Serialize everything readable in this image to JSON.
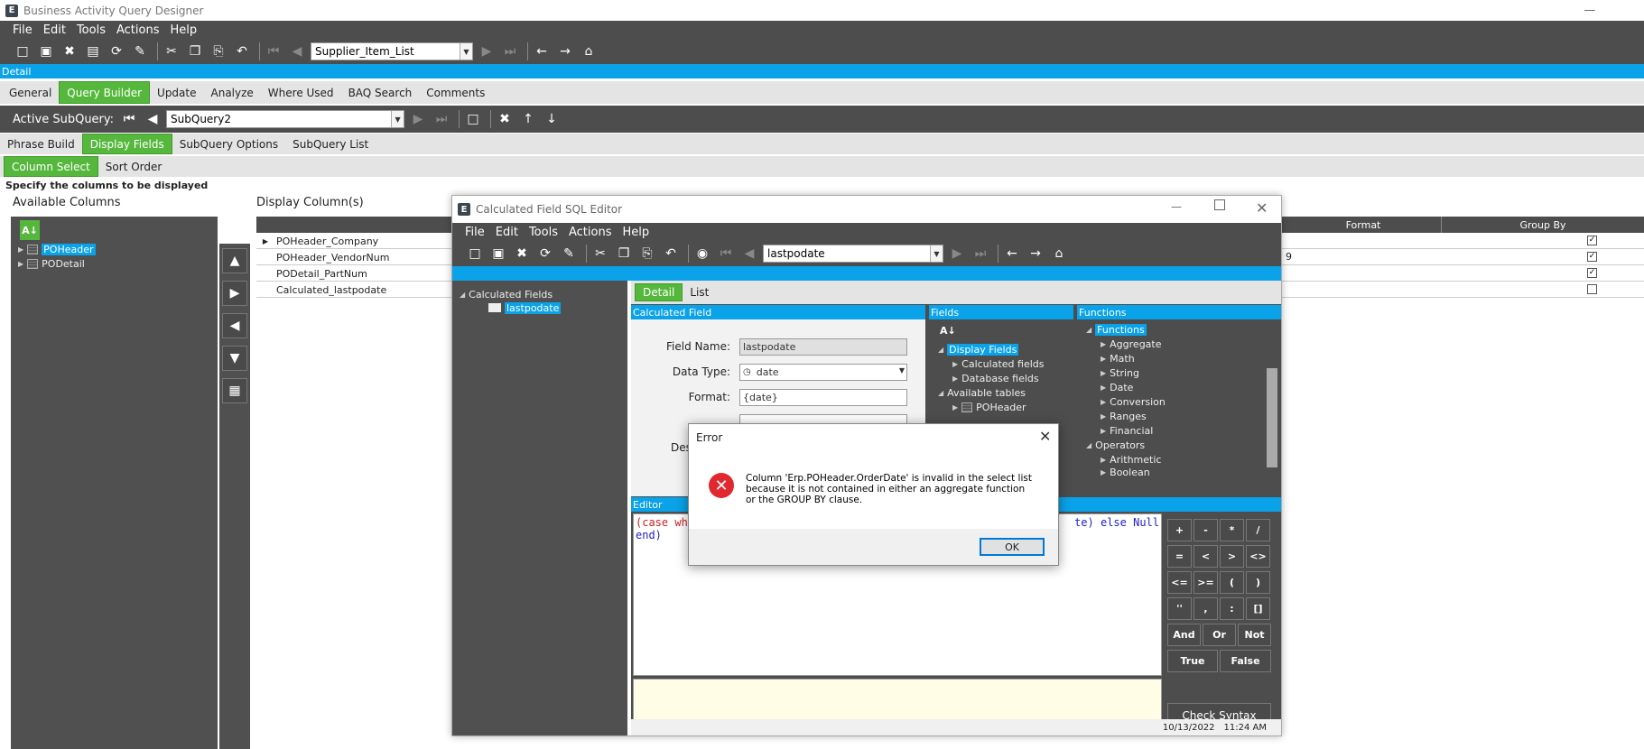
{
  "app": {
    "logo": "E",
    "title": "Business Activity Query Designer"
  },
  "menu": [
    "File",
    "Edit",
    "Tools",
    "Actions",
    "Help"
  ],
  "toolbar": {
    "query_name": "Supplier_Item_List"
  },
  "detail_bar": "Detail",
  "main_tabs": [
    "General",
    "Query Builder",
    "Update",
    "Analyze",
    "Where Used",
    "BAQ Search",
    "Comments"
  ],
  "subquery": {
    "label": "Active SubQuery:",
    "value": "SubQuery2"
  },
  "sub_tabs": [
    "Phrase Build",
    "Display Fields",
    "SubQuery Options",
    "SubQuery List"
  ],
  "col_tabs": [
    "Column Select",
    "Sort Order"
  ],
  "instruction": "Specify the columns to be displayed",
  "available_columns": {
    "label": "Available Columns",
    "items": [
      "POHeader",
      "PODetail"
    ]
  },
  "display_columns": {
    "label": "Display Column(s)",
    "headers": {
      "format": "Format",
      "group_by": "Group By"
    },
    "rows": [
      {
        "name": "POHeader_Company",
        "group_by": true
      },
      {
        "name": "POHeader_VendorNum",
        "group_by": true,
        "format_fragment": "9"
      },
      {
        "name": "PODetail_PartNum",
        "group_by": true
      },
      {
        "name": "Calculated_lastpodate",
        "group_by": false
      }
    ]
  },
  "calc_editor": {
    "title": "Calculated Field SQL Editor",
    "menu": [
      "File",
      "Edit",
      "Tools",
      "Actions",
      "Help"
    ],
    "combo_value": "lastpodate",
    "tree_root": "Calculated Fields",
    "tree_item": "lastpodate",
    "tabs": [
      "Detail",
      "List"
    ],
    "calc_field_header": "Calculated Field",
    "field_name_label": "Field Name:",
    "field_name": "lastpodate",
    "data_type_label": "Data Type:",
    "data_type": "date",
    "format_label": "Format:",
    "format": "{date}",
    "desc_label_fragment": "Des",
    "fields_header": "Fields",
    "fields_tree": [
      "Display Fields",
      "Calculated fields",
      "Database fields",
      "Available tables",
      "POHeader"
    ],
    "functions_header": "Functions",
    "functions_tree": [
      "Functions",
      "Aggregate",
      "Math",
      "String",
      "Date",
      "Conversion",
      "Ranges",
      "Financial",
      "Operators",
      "Arithmetic",
      "Boolean"
    ],
    "editor_header": "Editor",
    "code_line1_start": "(case whe",
    "code_line1_end": "te) else Null",
    "code_line2": "end)",
    "keypad": [
      "+",
      "-",
      "*",
      "/",
      "=",
      "<",
      ">",
      "<>",
      "<=",
      ">=",
      "(",
      ")",
      "''",
      ",",
      ":",
      "[]"
    ],
    "logic": [
      "And",
      "Or",
      "Not"
    ],
    "bools": [
      "True",
      "False"
    ],
    "check_syntax": "Check Syntax",
    "status_date": "10/13/2022",
    "status_time": "11:24 AM"
  },
  "error_dialog": {
    "title": "Error",
    "message": "Column 'Erp.POHeader.OrderDate' is invalid in the select list because it is not contained in either an aggregate function or the GROUP BY clause.",
    "ok": "OK"
  },
  "colors": {
    "accent_blue": "#0aa2e8",
    "accent_green": "#55b83d",
    "dark_gray": "#4d4d4d",
    "error_red": "#e0282e"
  }
}
